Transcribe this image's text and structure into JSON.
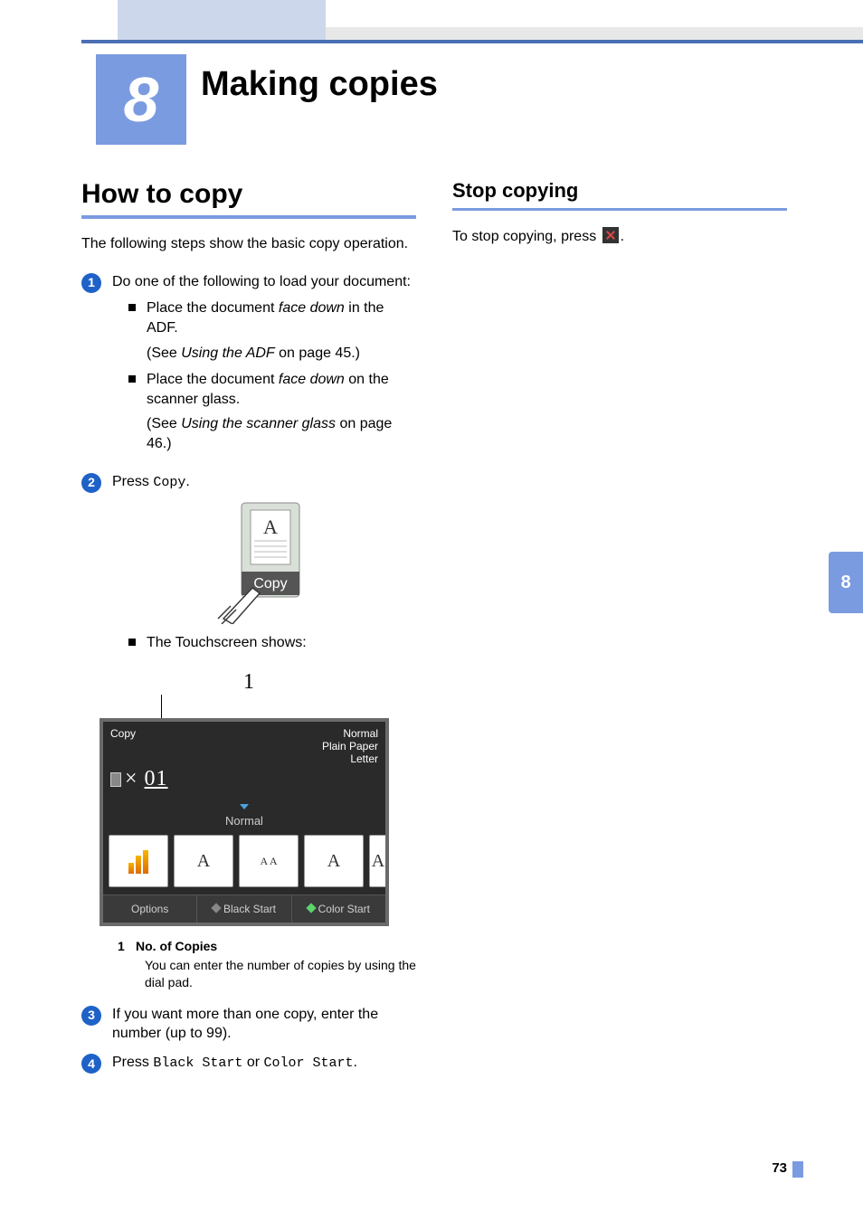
{
  "chapter": {
    "number": "8",
    "title": "Making copies"
  },
  "left": {
    "heading": "How to copy",
    "intro": "The following steps show the basic copy operation.",
    "step1": {
      "lead": "Do one of the following to load your document:",
      "bullet1_a": "Place the document ",
      "bullet1_b": "face down",
      "bullet1_c": " in the ADF.",
      "bullet1_ref_a": "(See ",
      "bullet1_ref_b": "Using the ADF",
      "bullet1_ref_c": " on page 45.)",
      "bullet2_a": "Place the document ",
      "bullet2_b": "face down",
      "bullet2_c": " on the scanner glass.",
      "bullet2_ref_a": "(See ",
      "bullet2_ref_b": "Using the scanner glass",
      "bullet2_ref_c": " on page 46.)"
    },
    "step2": {
      "press": "Press ",
      "key": "Copy",
      "dot": "."
    },
    "touchscreen_note": "The Touchscreen shows:",
    "device": {
      "title": "Copy",
      "status1": "Normal",
      "status2": "Plain Paper",
      "status3": "Letter",
      "count_prefix": "×",
      "count": "01",
      "mode": "Normal",
      "btn_options": "Options",
      "btn_black": "Black Start",
      "btn_color": "Color Start"
    },
    "callout1": "1",
    "legend": {
      "num": "1",
      "title": "No. of Copies",
      "desc": "You can enter the number of copies by using the dial pad."
    },
    "step3": "If you want more than one copy, enter the number (up to 99).",
    "step4": {
      "press": "Press ",
      "k1": "Black Start",
      "or": " or ",
      "k2": "Color Start",
      "dot": "."
    }
  },
  "right": {
    "heading": "Stop copying",
    "text_a": "To stop copying, press ",
    "text_b": "."
  },
  "sidetab": "8",
  "page_number": "73"
}
